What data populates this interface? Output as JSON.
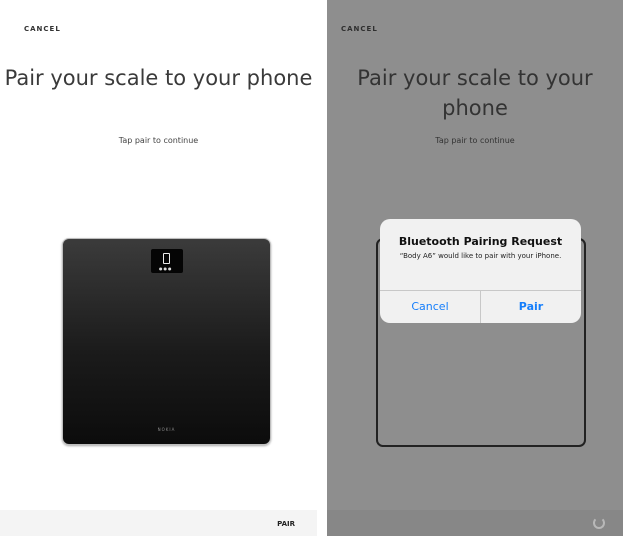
{
  "left": {
    "cancel_label": "CANCEL",
    "title": "Pair your scale to your phone",
    "subtitle": "Tap pair to continue",
    "scale_brand": "NOKIA",
    "pair_label": "PAIR"
  },
  "right": {
    "cancel_label": "CANCEL",
    "title": "Pair your scale to your phone",
    "subtitle": "Tap pair to continue",
    "alert": {
      "title": "Bluetooth Pairing Request",
      "message": "“Body A6” would like to pair with your iPhone.",
      "cancel_label": "Cancel",
      "pair_label": "Pair"
    },
    "loading_icon": "spinner-icon"
  },
  "colors": {
    "accent": "#157efb",
    "overlay": "#8e8e8e"
  }
}
